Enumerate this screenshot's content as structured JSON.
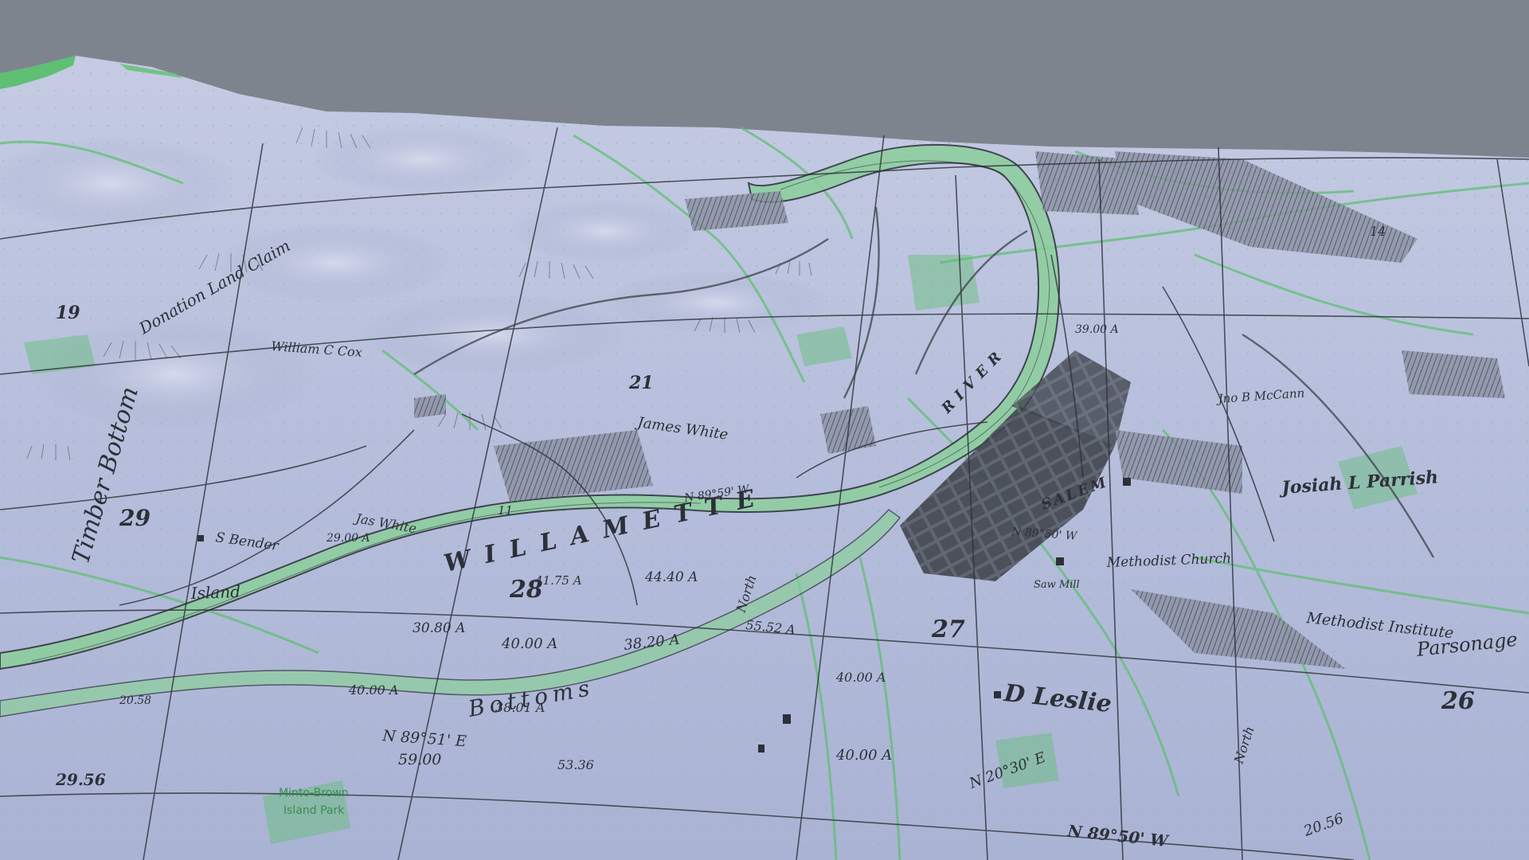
{
  "colors": {
    "sky": "#7d848e",
    "terrain": "#b7bfdc",
    "terrain_shade": "#9aa3c4",
    "ink": "#2c3038",
    "overlay_green": "#5fbf73",
    "river_fill": "#8ccf9c"
  },
  "labels": {
    "river": "WILLAMETTE",
    "river_r": "RIVER",
    "salem": "SALEM",
    "james_white": "James White",
    "jas_white": "Jas White",
    "william_cox": "William C Cox",
    "s_bender": "S Bender",
    "josiah_parrish": "Josiah L Parrish",
    "d_leslie": "D Leslie",
    "methodist_church": "Methodist Church",
    "methodist_institute": "Methodist Institute",
    "parsonage": "Parsonage",
    "saw_mill": "Saw Mill",
    "island": "Island",
    "bottoms": "Bottoms",
    "timber_bottom": "Timber Bottom",
    "north": "North",
    "donation": "Donation Land Claim",
    "jno_mccann": "Jno B McCann",
    "minto_brown": "Minto-Brown",
    "island_park": "Island Park",
    "section_29": "29",
    "section_28": "28",
    "section_27": "27",
    "section_26": "26",
    "section_21": "21",
    "section_14": "14",
    "section_11": "11",
    "section_19": "19",
    "acre_1": "44.40 A",
    "acre_2": "41.75 A",
    "acre_3": "40.00 A",
    "acre_4": "38.20 A",
    "acre_5": "30.80 A",
    "acre_6": "55.52 A",
    "acre_7": "40.00 A",
    "acre_8": "38.01 A",
    "acre_9": "40.00 A",
    "acre_10": "40.00 A",
    "acre_11": "39.00 A",
    "acre_12": "29.00 A",
    "bearing_1": "N 89°51' E",
    "bearing_2": "59.00",
    "bearing_3": "N 89°50' W",
    "bearing_4": "N 20°30' E",
    "bearing_5": "N 89°59' W",
    "bearing_6": "N 89°50' W",
    "num_1": "53.36",
    "num_2": "29.56",
    "num_3": "20.58",
    "num_4": "20.56"
  }
}
